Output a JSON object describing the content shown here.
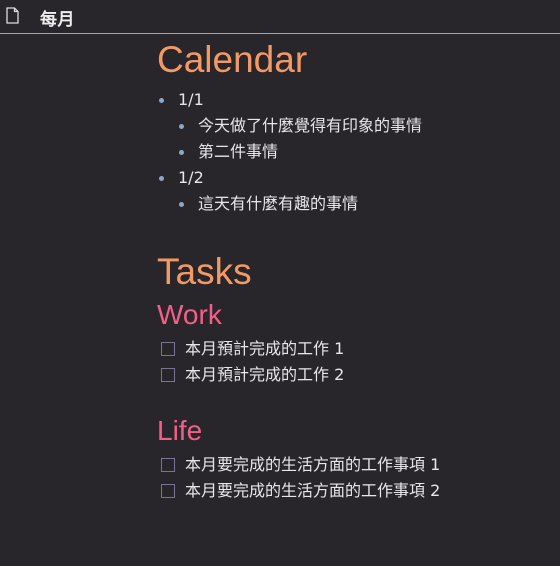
{
  "window": {
    "title": "每月",
    "icon": "document-icon"
  },
  "calendar": {
    "heading": "Calendar",
    "days": [
      {
        "label": "1/1",
        "items": [
          "今天做了什麼覺得有印象的事情",
          "第二件事情"
        ]
      },
      {
        "label": "1/2",
        "items": [
          "這天有什麼有趣的事情"
        ]
      }
    ]
  },
  "tasks": {
    "heading": "Tasks",
    "groups": [
      {
        "heading": "Work",
        "items": [
          "本月預計完成的工作 1",
          "本月預計完成的工作 2"
        ]
      },
      {
        "heading": "Life",
        "items": [
          "本月要完成的生活方面的工作事項 1",
          "本月要完成的生活方面的工作事項 2"
        ]
      }
    ]
  },
  "colors": {
    "background": "#28262a",
    "h1": "#f29a66",
    "h2": "#f0608a",
    "bullet": "#8fa7c4",
    "checkbox_border": "#7b7494",
    "divider": "#8fb1b6"
  }
}
